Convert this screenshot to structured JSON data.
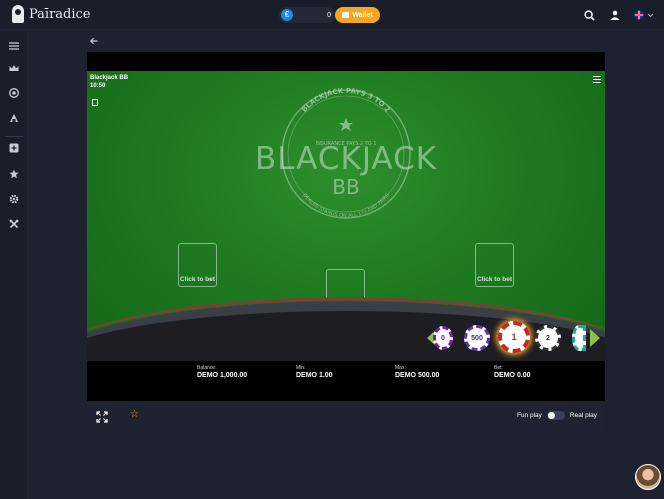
{
  "app": {
    "brand": "Paīradice"
  },
  "header": {
    "balance_amount": "0",
    "wallet_label": "Wallet"
  },
  "game": {
    "table_name": "Blackjack BB",
    "time": "10:50",
    "arc_top": "BLACKJACK PAYS 3 TO 2",
    "insurance": "INSURANCE PAYS 2 TO 1",
    "title": "BLACKJACK",
    "subtitle": "BB",
    "arc_bottom": "DEALER STANDS ON ALL 17s AND PAIRS",
    "bet_spot_label": "Click to bet",
    "chips": [
      "0",
      "500",
      "1",
      "2"
    ],
    "info": [
      {
        "label": "Balance:",
        "value": "DEMO 1,000.00"
      },
      {
        "label": "Min:",
        "value": "DEMO 1.00"
      },
      {
        "label": "Max:",
        "value": "DEMO 500.00"
      },
      {
        "label": "Bet:",
        "value": "DEMO 0.00"
      }
    ]
  },
  "footer": {
    "fun_play": "Fun play",
    "real_play": "Real play"
  },
  "colors": {
    "accent": "#f6a623",
    "felt": "#1f7a22",
    "chip_red": "#c62828"
  }
}
